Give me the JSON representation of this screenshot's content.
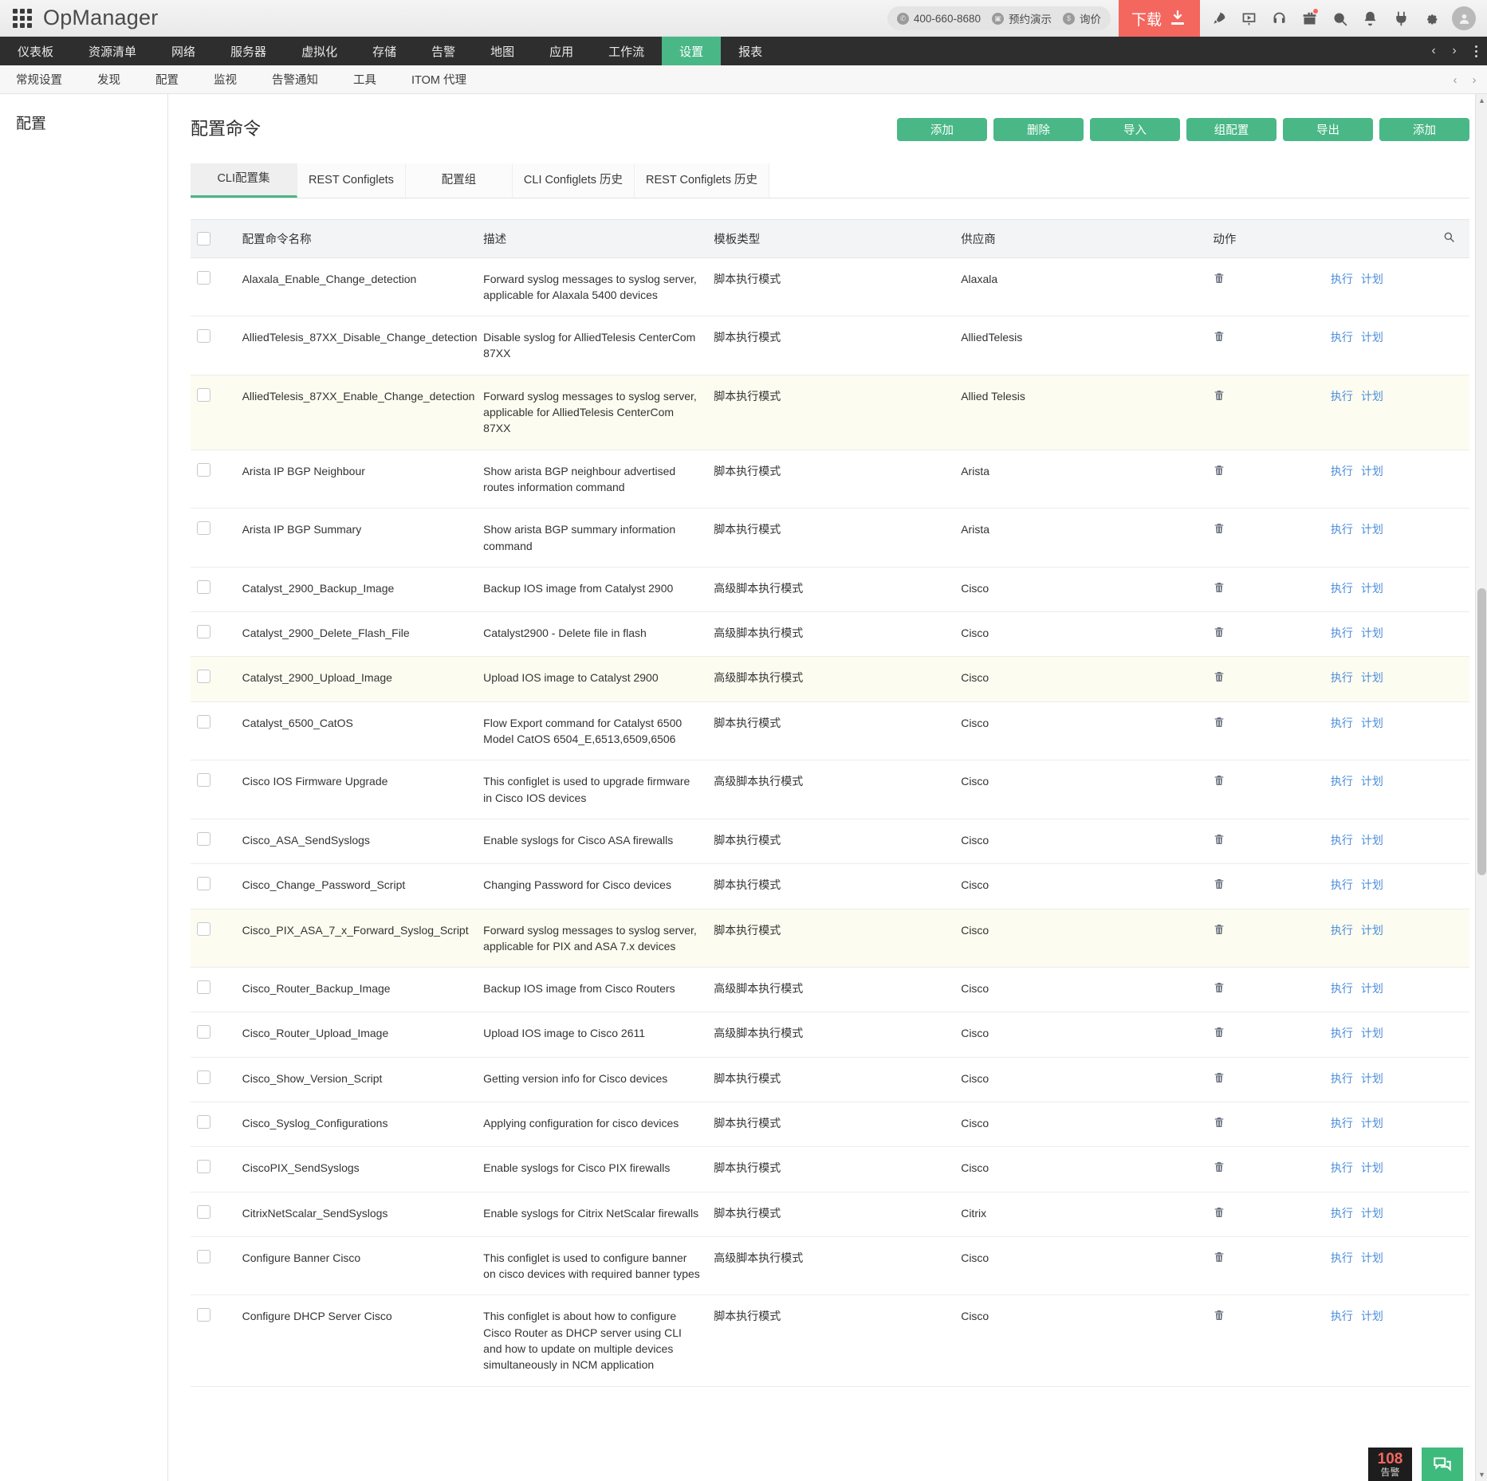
{
  "app": {
    "brand": "OpManager",
    "waffle_icon": "apps-grid-icon"
  },
  "header": {
    "phone": "400-660-8680",
    "demo_label": "预约演示",
    "price_label": "询价",
    "download_label": "下载",
    "icons": [
      {
        "name": "rocket-icon"
      },
      {
        "name": "presentation-video-icon"
      },
      {
        "name": "headset-support-icon"
      },
      {
        "name": "gift-icon"
      },
      {
        "name": "search-icon"
      },
      {
        "name": "bell-notification-icon"
      },
      {
        "name": "plug-addon-icon"
      },
      {
        "name": "gear-settings-icon"
      },
      {
        "name": "user-avatar-icon"
      }
    ]
  },
  "mainnav": {
    "items": [
      {
        "label": "仪表板",
        "active": false
      },
      {
        "label": "资源清单",
        "active": false
      },
      {
        "label": "网络",
        "active": false
      },
      {
        "label": "服务器",
        "active": false
      },
      {
        "label": "虚拟化",
        "active": false
      },
      {
        "label": "存储",
        "active": false
      },
      {
        "label": "告警",
        "active": false
      },
      {
        "label": "地图",
        "active": false
      },
      {
        "label": "应用",
        "active": false
      },
      {
        "label": "工作流",
        "active": false
      },
      {
        "label": "设置",
        "active": true
      },
      {
        "label": "报表",
        "active": false
      }
    ],
    "prev_arrow": "‹",
    "next_arrow": "›"
  },
  "subnav": {
    "items": [
      {
        "label": "常规设置"
      },
      {
        "label": "发现"
      },
      {
        "label": "配置"
      },
      {
        "label": "监视"
      },
      {
        "label": "告警通知"
      },
      {
        "label": "工具"
      },
      {
        "label": "ITOM 代理"
      }
    ],
    "prev_arrow": "‹",
    "next_arrow": "›"
  },
  "sidebar": {
    "title": "配置"
  },
  "main": {
    "page_title": "配置命令",
    "buttons": [
      {
        "label": "添加",
        "name": "add-button"
      },
      {
        "label": "删除",
        "name": "delete-button"
      },
      {
        "label": "导入",
        "name": "import-button"
      },
      {
        "label": "组配置",
        "name": "group-config-button"
      },
      {
        "label": "导出",
        "name": "export-button"
      },
      {
        "label": "添加",
        "name": "add-secondary-button"
      }
    ],
    "tabs": [
      {
        "label": "CLI配置集",
        "active": true
      },
      {
        "label": "REST Configlets",
        "active": false
      },
      {
        "label": "配置组",
        "active": false
      },
      {
        "label": "CLI Configlets 历史",
        "active": false
      },
      {
        "label": "REST Configlets 历史",
        "active": false
      }
    ],
    "table": {
      "columns": [
        "配置命令名称",
        "描述",
        "模板类型",
        "供应商",
        "动作"
      ],
      "search_icon": "search-icon",
      "action_links": {
        "run": "执行",
        "schedule": "计划"
      },
      "delete_icon": "trash-icon",
      "rows": [
        {
          "name": "Alaxala_Enable_Change_detection",
          "desc": "Forward syslog messages to syslog server, applicable for Alaxala 5400 devices",
          "type": "脚本执行模式",
          "vendor": "Alaxala",
          "highlight": false
        },
        {
          "name": "AlliedTelesis_87XX_Disable_Change_detection",
          "desc": "Disable syslog for AlliedTelesis CenterCom 87XX",
          "type": "脚本执行模式",
          "vendor": "AlliedTelesis",
          "highlight": false
        },
        {
          "name": "AlliedTelesis_87XX_Enable_Change_detection",
          "desc": "Forward syslog messages to syslog server, applicable for AlliedTelesis CenterCom 87XX",
          "type": "脚本执行模式",
          "vendor": "Allied Telesis",
          "highlight": true
        },
        {
          "name": "Arista IP BGP Neighbour",
          "desc": "Show arista BGP neighbour advertised routes information command",
          "type": "脚本执行模式",
          "vendor": "Arista",
          "highlight": false
        },
        {
          "name": "Arista IP BGP Summary",
          "desc": "Show arista BGP summary information command",
          "type": "脚本执行模式",
          "vendor": "Arista",
          "highlight": false
        },
        {
          "name": "Catalyst_2900_Backup_Image",
          "desc": "Backup IOS image from Catalyst 2900",
          "type": "高级脚本执行模式",
          "vendor": "Cisco",
          "highlight": false
        },
        {
          "name": "Catalyst_2900_Delete_Flash_File",
          "desc": "Catalyst2900 - Delete file in flash",
          "type": "高级脚本执行模式",
          "vendor": "Cisco",
          "highlight": false
        },
        {
          "name": "Catalyst_2900_Upload_Image",
          "desc": "Upload IOS image to Catalyst 2900",
          "type": "高级脚本执行模式",
          "vendor": "Cisco",
          "highlight": true
        },
        {
          "name": "Catalyst_6500_CatOS",
          "desc": "Flow Export command for Catalyst 6500 Model CatOS 6504_E,6513,6509,6506",
          "type": "脚本执行模式",
          "vendor": "Cisco",
          "highlight": false
        },
        {
          "name": "Cisco IOS Firmware Upgrade",
          "desc": "This configlet is used to upgrade firmware in Cisco IOS devices",
          "type": "高级脚本执行模式",
          "vendor": "Cisco",
          "highlight": false
        },
        {
          "name": "Cisco_ASA_SendSyslogs",
          "desc": "Enable syslogs for Cisco ASA firewalls",
          "type": "脚本执行模式",
          "vendor": "Cisco",
          "highlight": false
        },
        {
          "name": "Cisco_Change_Password_Script",
          "desc": "Changing Password for Cisco devices",
          "type": "脚本执行模式",
          "vendor": "Cisco",
          "highlight": false
        },
        {
          "name": "Cisco_PIX_ASA_7_x_Forward_Syslog_Script",
          "desc": "Forward syslog messages to syslog server, applicable for PIX and ASA 7.x devices",
          "type": "脚本执行模式",
          "vendor": "Cisco",
          "highlight": true
        },
        {
          "name": "Cisco_Router_Backup_Image",
          "desc": "Backup IOS image from Cisco Routers",
          "type": "高级脚本执行模式",
          "vendor": "Cisco",
          "highlight": false
        },
        {
          "name": "Cisco_Router_Upload_Image",
          "desc": "Upload IOS image to Cisco 2611",
          "type": "高级脚本执行模式",
          "vendor": "Cisco",
          "highlight": false
        },
        {
          "name": "Cisco_Show_Version_Script",
          "desc": "Getting version info for Cisco devices",
          "type": "脚本执行模式",
          "vendor": "Cisco",
          "highlight": false
        },
        {
          "name": "Cisco_Syslog_Configurations",
          "desc": "Applying configuration for cisco devices",
          "type": "脚本执行模式",
          "vendor": "Cisco",
          "highlight": false
        },
        {
          "name": "CiscoPIX_SendSyslogs",
          "desc": "Enable syslogs for Cisco PIX firewalls",
          "type": "脚本执行模式",
          "vendor": "Cisco",
          "highlight": false
        },
        {
          "name": "CitrixNetScalar_SendSyslogs",
          "desc": "Enable syslogs for Citrix NetScalar firewalls",
          "type": "脚本执行模式",
          "vendor": "Citrix",
          "highlight": false
        },
        {
          "name": "Configure Banner Cisco",
          "desc": "This configlet is used to configure banner on cisco devices with required banner types",
          "type": "高级脚本执行模式",
          "vendor": "Cisco",
          "highlight": false
        },
        {
          "name": "Configure DHCP Server Cisco",
          "desc": "This configlet is about how to configure Cisco Router as DHCP server using CLI and how to update on multiple devices simultaneously in NCM application",
          "type": "脚本执行模式",
          "vendor": "Cisco",
          "highlight": false
        }
      ]
    }
  },
  "floaters": {
    "alarm_count": "108",
    "alarm_label": "告警",
    "chat_icon": "chat-bubbles-icon"
  },
  "colors": {
    "accent_green": "#4ab787",
    "download_red": "#f4675e",
    "nav_dark": "#2e2e2e",
    "link_blue": "#4b8ddb",
    "row_highlight": "#fdfcf0"
  }
}
